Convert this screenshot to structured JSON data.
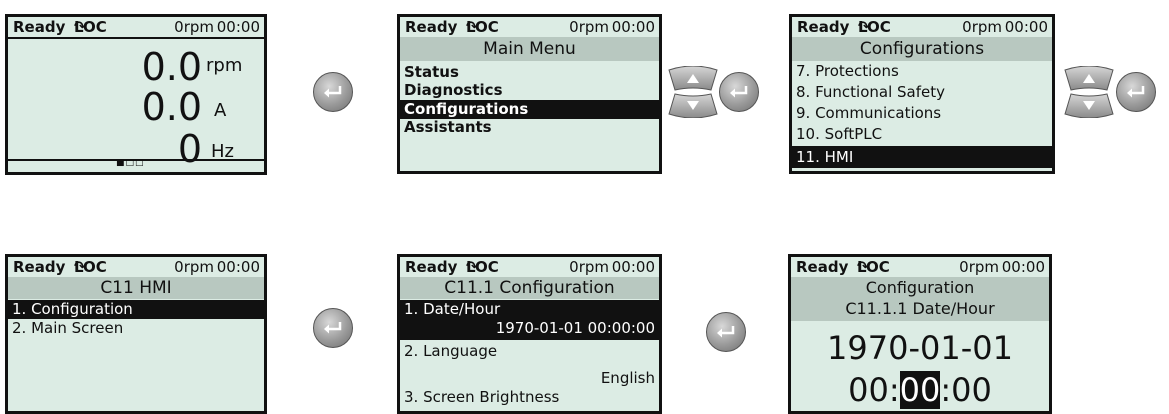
{
  "status": {
    "ready": "Ready",
    "loc": "LOC",
    "rpm": "0rpm",
    "time": "00:00",
    "rotation_icon": "rotation-arrow-icon"
  },
  "screen1": {
    "values": [
      {
        "value": "0.0",
        "unit": "rpm"
      },
      {
        "value": "0.0",
        "unit": "A"
      },
      {
        "value": "0",
        "unit": "Hz"
      }
    ],
    "page_indicator": "■□□"
  },
  "screen2": {
    "title": "Main Menu",
    "items": [
      "Status",
      "Diagnostics",
      "Configurations",
      "Assistants"
    ],
    "selected_index": 2
  },
  "screen3": {
    "title": "Configurations",
    "items": [
      "7. Protections",
      "8. Functional Safety",
      "9. Communications",
      "10. SoftPLC",
      "11. HMI"
    ],
    "selected_index": 4
  },
  "screen4": {
    "title": "C11 HMI",
    "items": [
      "1. Configuration",
      "2. Main Screen"
    ],
    "selected_index": 0
  },
  "screen5": {
    "title": "C11.1 Configuration",
    "item1_label": "1. Date/Hour",
    "item1_value": "1970-01-01 00:00:00",
    "item2_label": "2. Language",
    "item2_value": "English",
    "item3_label": "3. Screen Brightness"
  },
  "screen6": {
    "title_line1": "Configuration",
    "title_line2": "C11.1.1 Date/Hour",
    "date": "1970-01-01",
    "time_hh": "00",
    "time_sep1": ":",
    "time_mm": "00",
    "time_sep2": ":",
    "time_ss": "00"
  },
  "icons": {
    "enter": "enter-key-icon",
    "updown": "up-down-arrow-keys-icon"
  }
}
